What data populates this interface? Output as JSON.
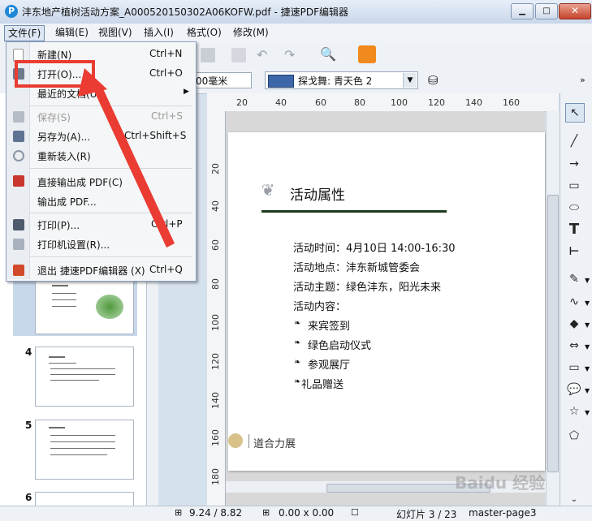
{
  "window": {
    "title": "沣东地产植树活动方案_A000520150302A06KOFW.pdf - 捷速PDF编辑器",
    "app_icon_letter": "P"
  },
  "menubar": [
    "文件(F)",
    "编辑(E)",
    "视图(V)",
    "插入(I)",
    "格式(O)",
    "修改(M)"
  ],
  "toolbar2": {
    "size_value": "00毫米",
    "fill_color_label": "探戈舞: 青天色 2",
    "fill_color_hex": "#3d67a8"
  },
  "file_menu": {
    "items": [
      {
        "label": "新建(N)",
        "shortcut": "Ctrl+N",
        "enabled": true
      },
      {
        "label": "打开(O)...",
        "shortcut": "Ctrl+O",
        "enabled": true
      },
      {
        "label": "最近的文档(U)",
        "shortcut": "",
        "enabled": true,
        "submenu": true
      },
      {
        "label": "保存(S)",
        "shortcut": "Ctrl+S",
        "enabled": false
      },
      {
        "label": "另存为(A)...",
        "shortcut": "Ctrl+Shift+S",
        "enabled": true
      },
      {
        "label": "重新装入(R)",
        "shortcut": "",
        "enabled": true
      },
      {
        "label": "直接输出成 PDF(C)",
        "shortcut": "",
        "enabled": true
      },
      {
        "label": "输出成 PDF...",
        "shortcut": "",
        "enabled": true
      },
      {
        "label": "打印(P)...",
        "shortcut": "Ctrl+P",
        "enabled": true
      },
      {
        "label": "打印机设置(R)...",
        "shortcut": "",
        "enabled": true
      },
      {
        "label": "退出 捷速PDF编辑器 (X)",
        "shortcut": "Ctrl+Q",
        "enabled": true
      }
    ],
    "submenu_arrow": "▶"
  },
  "rulers": {
    "h": [
      "20",
      "40",
      "60",
      "80",
      "100",
      "120",
      "140",
      "160"
    ],
    "v": [
      "20",
      "40",
      "60",
      "80",
      "100",
      "120",
      "140",
      "160",
      "180"
    ]
  },
  "slide_thumbs": [
    "4",
    "5",
    "6"
  ],
  "slide": {
    "title": "活动属性",
    "lines": [
      "活动时间：4月10日 14:00-16:30",
      "活动地点：沣东新城管委会",
      "活动主题：绿色沣东，阳光未来",
      "活动内容："
    ],
    "bullets": [
      "来宾签到",
      "绿色启动仪式",
      "参观展厅",
      "礼品赠送"
    ],
    "footer": "道合力展"
  },
  "statusbar": {
    "position": "9.24 / 8.82",
    "size": "0.00 x 0.00",
    "slide": "幻灯片 3 / 23",
    "master": "master-page3"
  },
  "watermark": "Baidu 经验",
  "colors": {
    "highlight": "#ea3c32",
    "title_rule": "#1f3b1f"
  }
}
